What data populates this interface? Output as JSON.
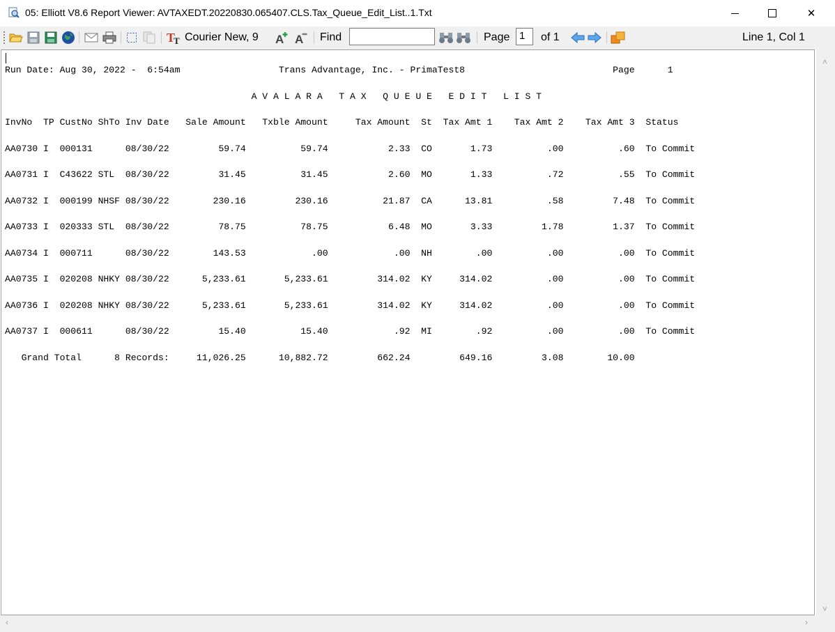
{
  "window": {
    "title": "05: Elliott V8.6 Report Viewer: AVTAXEDT.20220830.065407.CLS.Tax_Queue_Edit_List..1.Txt",
    "minimize_glyph": "",
    "close_glyph": "✕"
  },
  "toolbar": {
    "font_label": "Courier New, 9",
    "find_label": "Find",
    "find_value": "",
    "page_label": "Page",
    "page_value": "1",
    "page_of": "of 1",
    "position": "Line 1, Col 1",
    "icons": [
      "open-folder-icon",
      "save-icon",
      "save-as-icon",
      "globe-icon",
      "email-icon",
      "print-icon",
      "select-all-icon",
      "copy-icon",
      "font-icon",
      "increase-font-icon",
      "decrease-font-icon",
      "find-icon",
      "find-next-icon",
      "prev-page-icon",
      "next-page-icon",
      "export-icon",
      "help-icon"
    ]
  },
  "report": {
    "lines": [
      "Run Date: Aug 30, 2022 -  6:54am                  Trans Advantage, Inc. - PrimaTest8                           Page      1",
      "",
      "                                             A V A L A R A   T A X   Q U E U E   E D I T   L I S T",
      "",
      "InvNo  TP CustNo ShTo Inv Date   Sale Amount   Txble Amount     Tax Amount  St  Tax Amt 1    Tax Amt 2    Tax Amt 3  Status",
      "",
      "AA0730 I  000131      08/30/22         59.74          59.74           2.33  CO       1.73          .00          .60  To Commit",
      "",
      "AA0731 I  C43622 STL  08/30/22         31.45          31.45           2.60  MO       1.33          .72          .55  To Commit",
      "",
      "AA0732 I  000199 NHSF 08/30/22        230.16         230.16          21.87  CA      13.81          .58         7.48  To Commit",
      "",
      "AA0733 I  020333 STL  08/30/22         78.75          78.75           6.48  MO       3.33         1.78         1.37  To Commit",
      "",
      "AA0734 I  000711      08/30/22        143.53            .00            .00  NH        .00          .00          .00  To Commit",
      "",
      "AA0735 I  020208 NHKY 08/30/22      5,233.61       5,233.61         314.02  KY     314.02          .00          .00  To Commit",
      "",
      "AA0736 I  020208 NHKY 08/30/22      5,233.61       5,233.61         314.02  KY     314.02          .00          .00  To Commit",
      "",
      "AA0737 I  000611      08/30/22         15.40          15.40            .92  MI        .92          .00          .00  To Commit",
      "",
      "   Grand Total      8 Records:     11,026.25      10,882.72         662.24         649.16         3.08        10.00"
    ]
  },
  "colors": {
    "window_bg": "#ffffff",
    "toolbar_bg": "#f0f0f0",
    "arrow_blue": "#3c8de0",
    "font_icon_red": "#c0392b"
  }
}
